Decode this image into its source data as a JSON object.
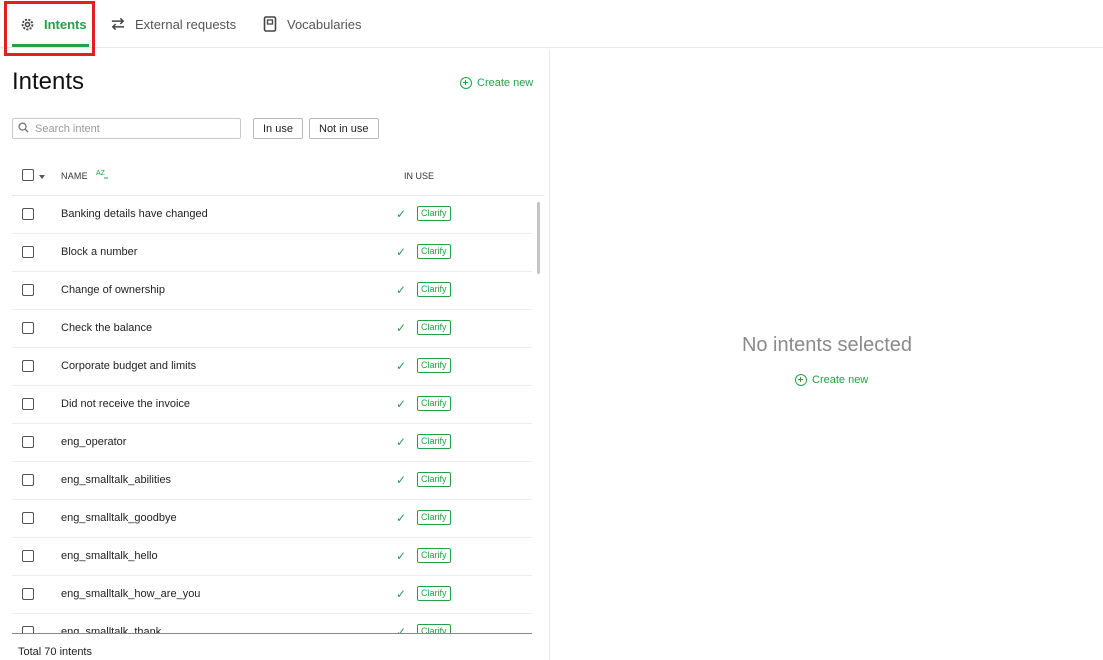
{
  "tabs": [
    {
      "label": "Intents",
      "icon": "intents-gear-icon",
      "active": true
    },
    {
      "label": "External requests",
      "icon": "api-arrows-icon",
      "active": false
    },
    {
      "label": "Vocabularies",
      "icon": "book-icon",
      "active": false
    }
  ],
  "left": {
    "title": "Intents",
    "create_label": "Create new",
    "search_placeholder": "Search intent",
    "filters": [
      "In use",
      "Not in use"
    ],
    "columns": {
      "name": "NAME",
      "sort_icon": "AZ",
      "in_use": "IN USE"
    },
    "rows": [
      {
        "name": "Banking details have changed",
        "badge": "Clarify"
      },
      {
        "name": "Block a number",
        "badge": "Clarify"
      },
      {
        "name": "Change of ownership",
        "badge": "Clarify"
      },
      {
        "name": "Check the balance",
        "badge": "Clarify"
      },
      {
        "name": "Corporate budget and limits",
        "badge": "Clarify"
      },
      {
        "name": "Did not receive the invoice",
        "badge": "Clarify"
      },
      {
        "name": "eng_operator",
        "badge": "Clarify"
      },
      {
        "name": "eng_smalltalk_abilities",
        "badge": "Clarify"
      },
      {
        "name": "eng_smalltalk_goodbye",
        "badge": "Clarify"
      },
      {
        "name": "eng_smalltalk_hello",
        "badge": "Clarify"
      },
      {
        "name": "eng_smalltalk_how_are_you",
        "badge": "Clarify"
      },
      {
        "name": "eng_smalltalk_thank",
        "badge": "Clarify"
      }
    ],
    "total": "Total 70 intents"
  },
  "right": {
    "empty_message": "No intents selected",
    "create_label": "Create new"
  },
  "colors": {
    "accent": "#24a148",
    "highlight": "#e31e24"
  }
}
